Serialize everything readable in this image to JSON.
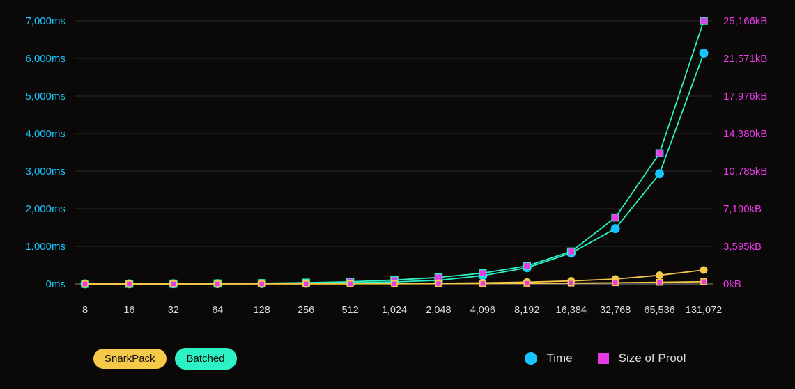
{
  "chart_data": {
    "type": "line",
    "categories": [
      "8",
      "16",
      "32",
      "64",
      "128",
      "256",
      "512",
      "1,024",
      "2,048",
      "4,096",
      "8,192",
      "16,384",
      "32,768",
      "65,536",
      "131,072"
    ],
    "y_left_ticks": [
      "0ms",
      "1,000ms",
      "2,000ms",
      "3,000ms",
      "4,000ms",
      "5,000ms",
      "6,000ms",
      "7,000ms"
    ],
    "y_right_ticks": [
      "0kB",
      "3,595kB",
      "7,190kB",
      "10,785kB",
      "14,380kB",
      "17,976kB",
      "21,571kB",
      "25,166kB"
    ],
    "y_left_range": [
      0,
      7000
    ],
    "y_right_range": [
      0,
      25166
    ],
    "series": [
      {
        "name": "Batched — Time",
        "axis": "left",
        "style": "batched-time",
        "values": [
          2,
          3,
          4,
          6,
          10,
          18,
          30,
          55,
          95,
          220,
          430,
          820,
          1470,
          2930,
          6140
        ]
      },
      {
        "name": "Batched — Size of Proof",
        "axis": "right",
        "style": "batched-size",
        "values": [
          10,
          15,
          25,
          40,
          70,
          120,
          210,
          370,
          620,
          1030,
          1720,
          3100,
          6350,
          12500,
          25166
        ]
      },
      {
        "name": "SnarkPack — Time",
        "axis": "left",
        "style": "snark-time",
        "values": [
          2,
          2,
          3,
          3,
          4,
          5,
          7,
          10,
          18,
          30,
          48,
          80,
          130,
          230,
          370
        ]
      },
      {
        "name": "SnarkPack — Size of Proof",
        "axis": "right",
        "style": "snark-size",
        "values": [
          2,
          3,
          4,
          5,
          7,
          10,
          14,
          20,
          28,
          40,
          56,
          80,
          110,
          155,
          215
        ]
      }
    ],
    "legend": {
      "pill_snarkpack": "SnarkPack",
      "pill_batched": "Batched",
      "time_label": "Time",
      "size_label": "Size of Proof"
    }
  },
  "colors": {
    "accent_blue": "#17c4ff",
    "accent_pink": "#e83be8",
    "accent_green": "#2cf2c4",
    "accent_yellow": "#f7c948"
  }
}
